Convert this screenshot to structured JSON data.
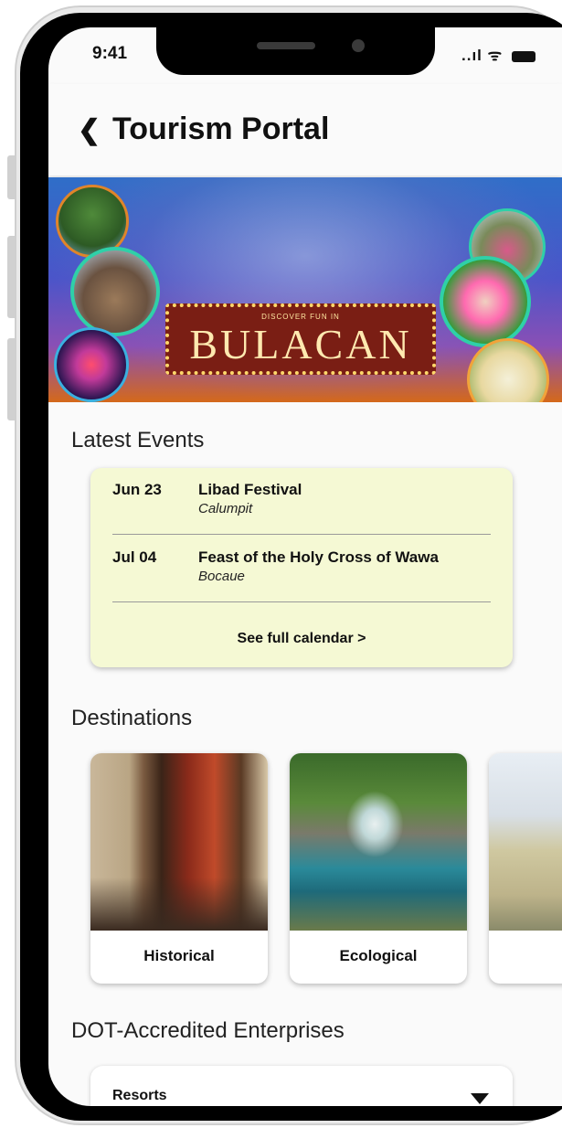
{
  "status_bar": {
    "time": "9:41",
    "signal": "..ıl",
    "wifi": "ᯤ"
  },
  "header": {
    "back_glyph": "❮",
    "title": "Tourism Portal"
  },
  "banner": {
    "subtitle": "DISCOVER FUN IN",
    "title": "BULACAN"
  },
  "events": {
    "heading": "Latest Events",
    "items": [
      {
        "date": "Jun 23",
        "name": "Libad Festival",
        "place": "Calumpit"
      },
      {
        "date": "Jul 04",
        "name": "Feast of the Holy Cross of Wawa",
        "place": "Bocaue"
      }
    ],
    "see_all": "See full calendar >"
  },
  "destinations": {
    "heading": "Destinations",
    "items": [
      {
        "label": "Historical"
      },
      {
        "label": "Ecological"
      },
      {
        "label": ""
      }
    ]
  },
  "enterprises": {
    "heading": "DOT-Accredited Enterprises",
    "selected": "Resorts"
  }
}
